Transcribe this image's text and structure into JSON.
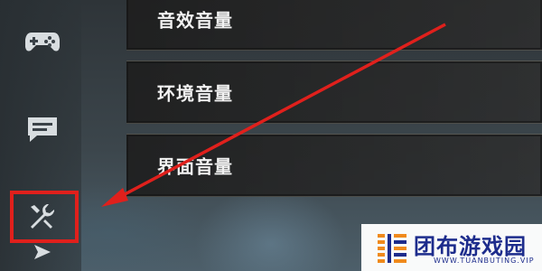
{
  "settings": {
    "items": [
      {
        "label": "音效音量"
      },
      {
        "label": "环境音量"
      },
      {
        "label": "界面音量"
      }
    ]
  },
  "sidebar": {
    "icons": [
      "gamepad-icon",
      "chat-icon",
      "wrench-settings-icon",
      "send-icon"
    ]
  },
  "annotation": {
    "highlight_color": "#e0201c",
    "arrow_color": "#e0201c"
  },
  "watermark": {
    "name": "团布游戏园",
    "domain": "WWW.TUANBUTING.VIP",
    "brand_color": "#1d2c8c",
    "accent_color": "#f08a1c"
  }
}
